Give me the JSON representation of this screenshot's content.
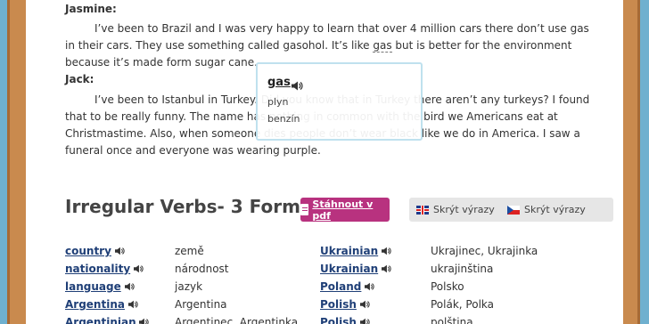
{
  "dialogue": [
    {
      "speaker": "Jasmine:",
      "text_before": "I’ve been to Brazil and I was very happy to learn that over 4 million cars there don’t use gas in their cars. They use something called gasohol. It’s like ",
      "highlight": "gas",
      "text_after": " but is better for the environment because it’s made form sugar cane."
    },
    {
      "speaker": "Jack:",
      "text": "I’ve been to Istanbul in Turkey. Did you know that in Turkey there aren’t any turkeys? I found that to be really funny. The name has nothing in common with the bird we Americans eat at Christmastime. Also, when someone dies people don’t wear black like we do in America. I saw a funeral once and everyone was wearing purple."
    }
  ],
  "popup": {
    "word": "gas",
    "translations": [
      "plyn",
      "benzín"
    ]
  },
  "section": {
    "title": "Irregular Verbs- 3 Forms",
    "pdf_button": "Stáhnout v pdf",
    "hide_en": "Skrýt výrazy",
    "hide_cz": "Skrýt výrazy"
  },
  "vocab_left": [
    {
      "en": "country",
      "cz": "země"
    },
    {
      "en": "nationality",
      "cz": "národnost"
    },
    {
      "en": "language",
      "cz": "jazyk"
    },
    {
      "en": "Argentina",
      "cz": "Argentina"
    },
    {
      "en": "Argentinian",
      "cz": "Argentinec, Argentinka"
    }
  ],
  "vocab_right": [
    {
      "en": "Ukrainian",
      "cz": "Ukrajinec, Ukrajinka"
    },
    {
      "en": "Ukrainian",
      "cz": "ukrajinština"
    },
    {
      "en": "Poland",
      "cz": "Polsko"
    },
    {
      "en": "Polish",
      "cz": "Polák, Polka"
    },
    {
      "en": "Polish",
      "cz": "polština"
    }
  ],
  "colors": {
    "accent": "#b8327f",
    "link": "#1f3f77",
    "frame": "#c98a4e",
    "background": "#6fb0cf"
  },
  "icons": {
    "speaker": "speaker-icon",
    "pdf": "pdf-icon",
    "flag_en": "uk-flag-icon",
    "flag_cz": "czech-flag-icon"
  }
}
